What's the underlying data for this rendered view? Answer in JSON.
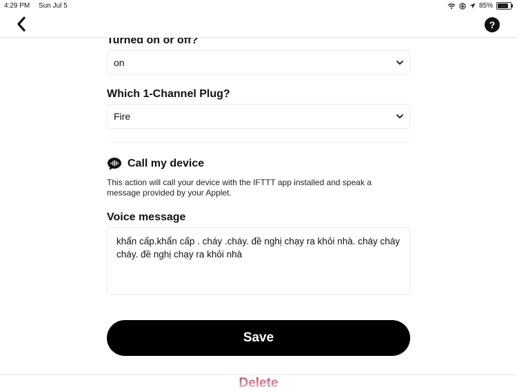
{
  "status_bar": {
    "time": "4:29 PM",
    "date": "Sun Jul 5",
    "battery": "85%"
  },
  "nav": {
    "back_icon": "chevron-left-icon",
    "help_label": "?"
  },
  "fields": {
    "turned_on_off": {
      "label": "Turned on or off?",
      "value": "on"
    },
    "plug": {
      "label": "Which 1-Channel Plug?",
      "value": "Fire"
    }
  },
  "action": {
    "icon": "voice-call-bubble-icon",
    "title": "Call my device",
    "description": "This action will call your device with the IFTTT app installed and speak a message provided by your Applet.",
    "voice_label": "Voice message",
    "voice_value": "khẩn cấp.khẩn cấp . cháy .cháy. đề nghị chạy ra khỏi nhà. cháy cháy cháy. đề nghị chạy ra khỏi nhà"
  },
  "buttons": {
    "save": "Save",
    "delete": "Delete"
  },
  "colors": {
    "primary": "#000000",
    "danger": "#b00020",
    "border": "#ececec"
  }
}
